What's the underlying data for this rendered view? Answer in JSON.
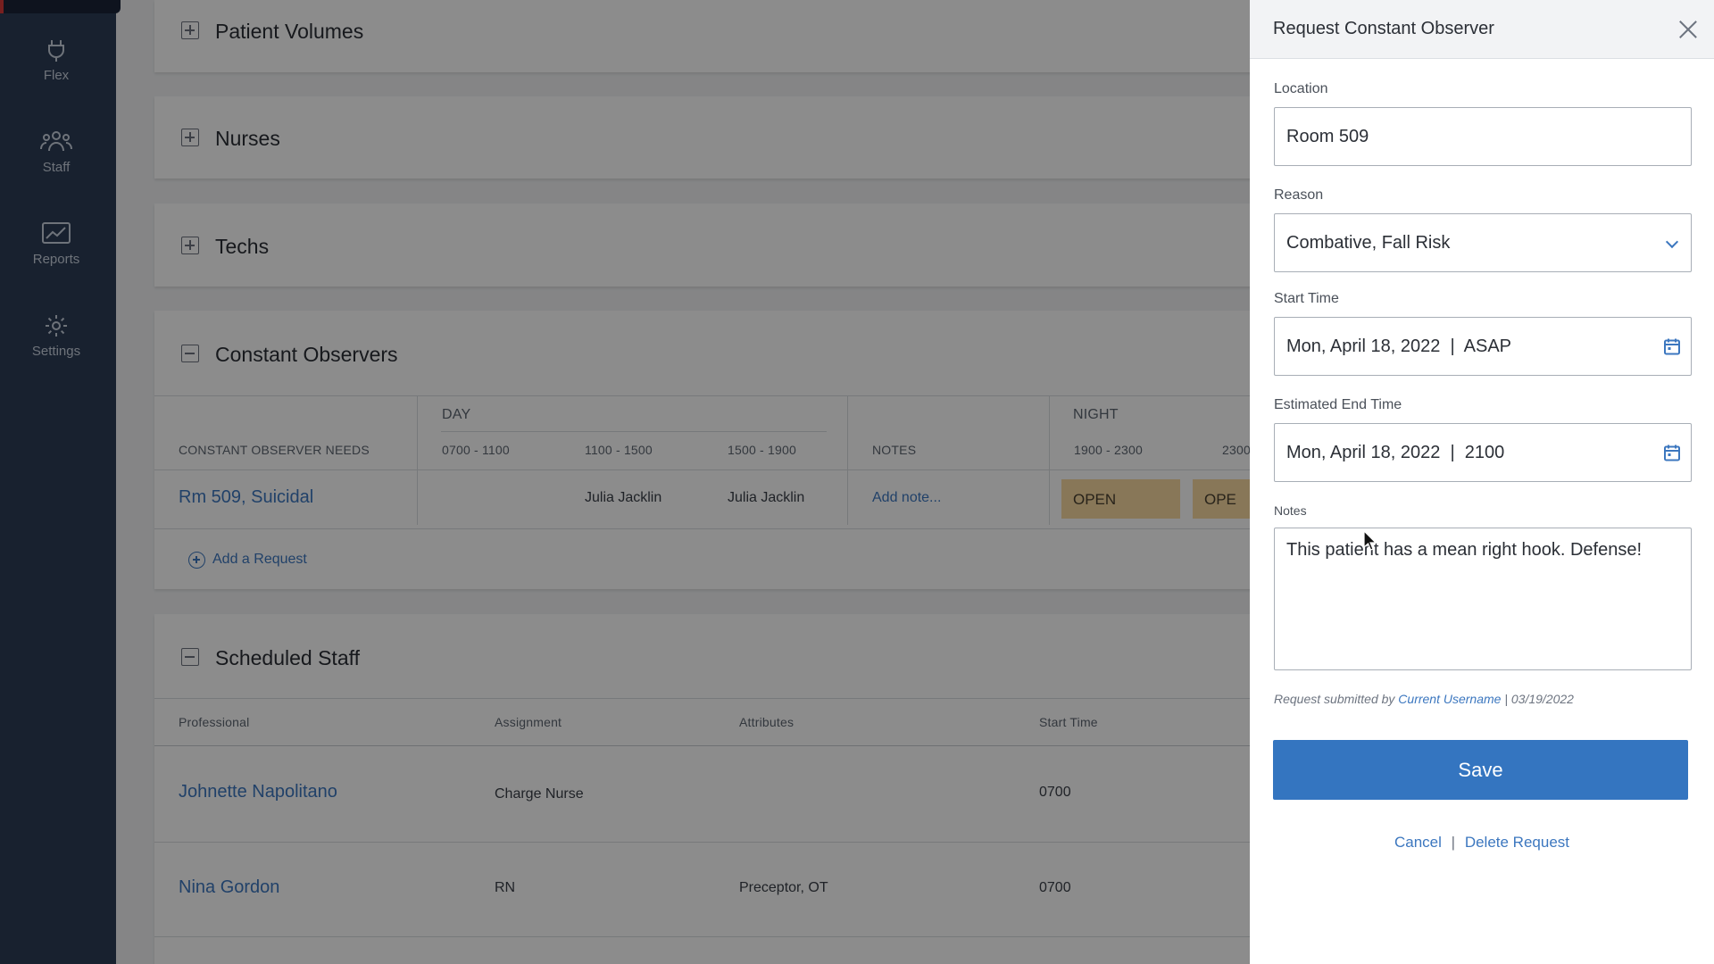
{
  "sidebar": {
    "items": [
      {
        "label": "Flex",
        "icon": "plug-icon"
      },
      {
        "label": "Staff",
        "icon": "people-icon"
      },
      {
        "label": "Reports",
        "icon": "chart-icon"
      },
      {
        "label": "Settings",
        "icon": "gear-icon"
      }
    ]
  },
  "sections": {
    "patient_volumes": "Patient Volumes",
    "nurses": "Nurses",
    "techs": "Techs",
    "constant_observers": "Constant Observers",
    "scheduled_staff": "Scheduled Staff"
  },
  "co_table": {
    "needs_header": "CONSTANT OBSERVER NEEDS",
    "day_header": "DAY",
    "night_header": "NIGHT",
    "notes_header": "NOTES",
    "slots": [
      "0700 - 1100",
      "1100 - 1500",
      "1500 - 1900",
      "1900 - 2300",
      "2300"
    ],
    "row": {
      "need": "Rm 509, Suicidal",
      "slot1": "",
      "slot2": "Julia Jacklin",
      "slot3": "Julia Jacklin",
      "note": "Add note...",
      "night1": "OPEN",
      "night2": "OPE"
    },
    "add_request": "Add a Request"
  },
  "staff_table": {
    "headers": {
      "professional": "Professional",
      "assignment": "Assignment",
      "attributes": "Attributes",
      "start_time": "Start Time"
    },
    "rows": [
      {
        "name": "Johnette Napolitano",
        "assignment": "Charge Nurse",
        "attributes": "",
        "start": "0700"
      },
      {
        "name": "Nina Gordon",
        "assignment": "RN",
        "attributes": "Preceptor, OT",
        "start": "0700"
      }
    ]
  },
  "panel": {
    "title": "Request Constant Observer",
    "location_label": "Location",
    "location_value": "Room 509",
    "reason_label": "Reason",
    "reason_value": "Combative, Fall Risk",
    "start_label": "Start Time",
    "start_value": "Mon, April 18, 2022  |  ASAP",
    "end_label": "Estimated End Time",
    "end_value": "Mon, April 18, 2022  |  2100",
    "notes_label": "Notes",
    "notes_value": "This patient has a mean right hook. Defense!",
    "submitted_prefix": "Request submitted by",
    "submitted_user": "Current Username",
    "submitted_date": "| 03/19/2022",
    "save_label": "Save",
    "cancel_label": "Cancel",
    "separator": "|",
    "delete_label": "Delete Request"
  },
  "colors": {
    "sidebar": "#2c3c56",
    "accent": "#3475c0",
    "open_chip": "#f7d9a1"
  }
}
